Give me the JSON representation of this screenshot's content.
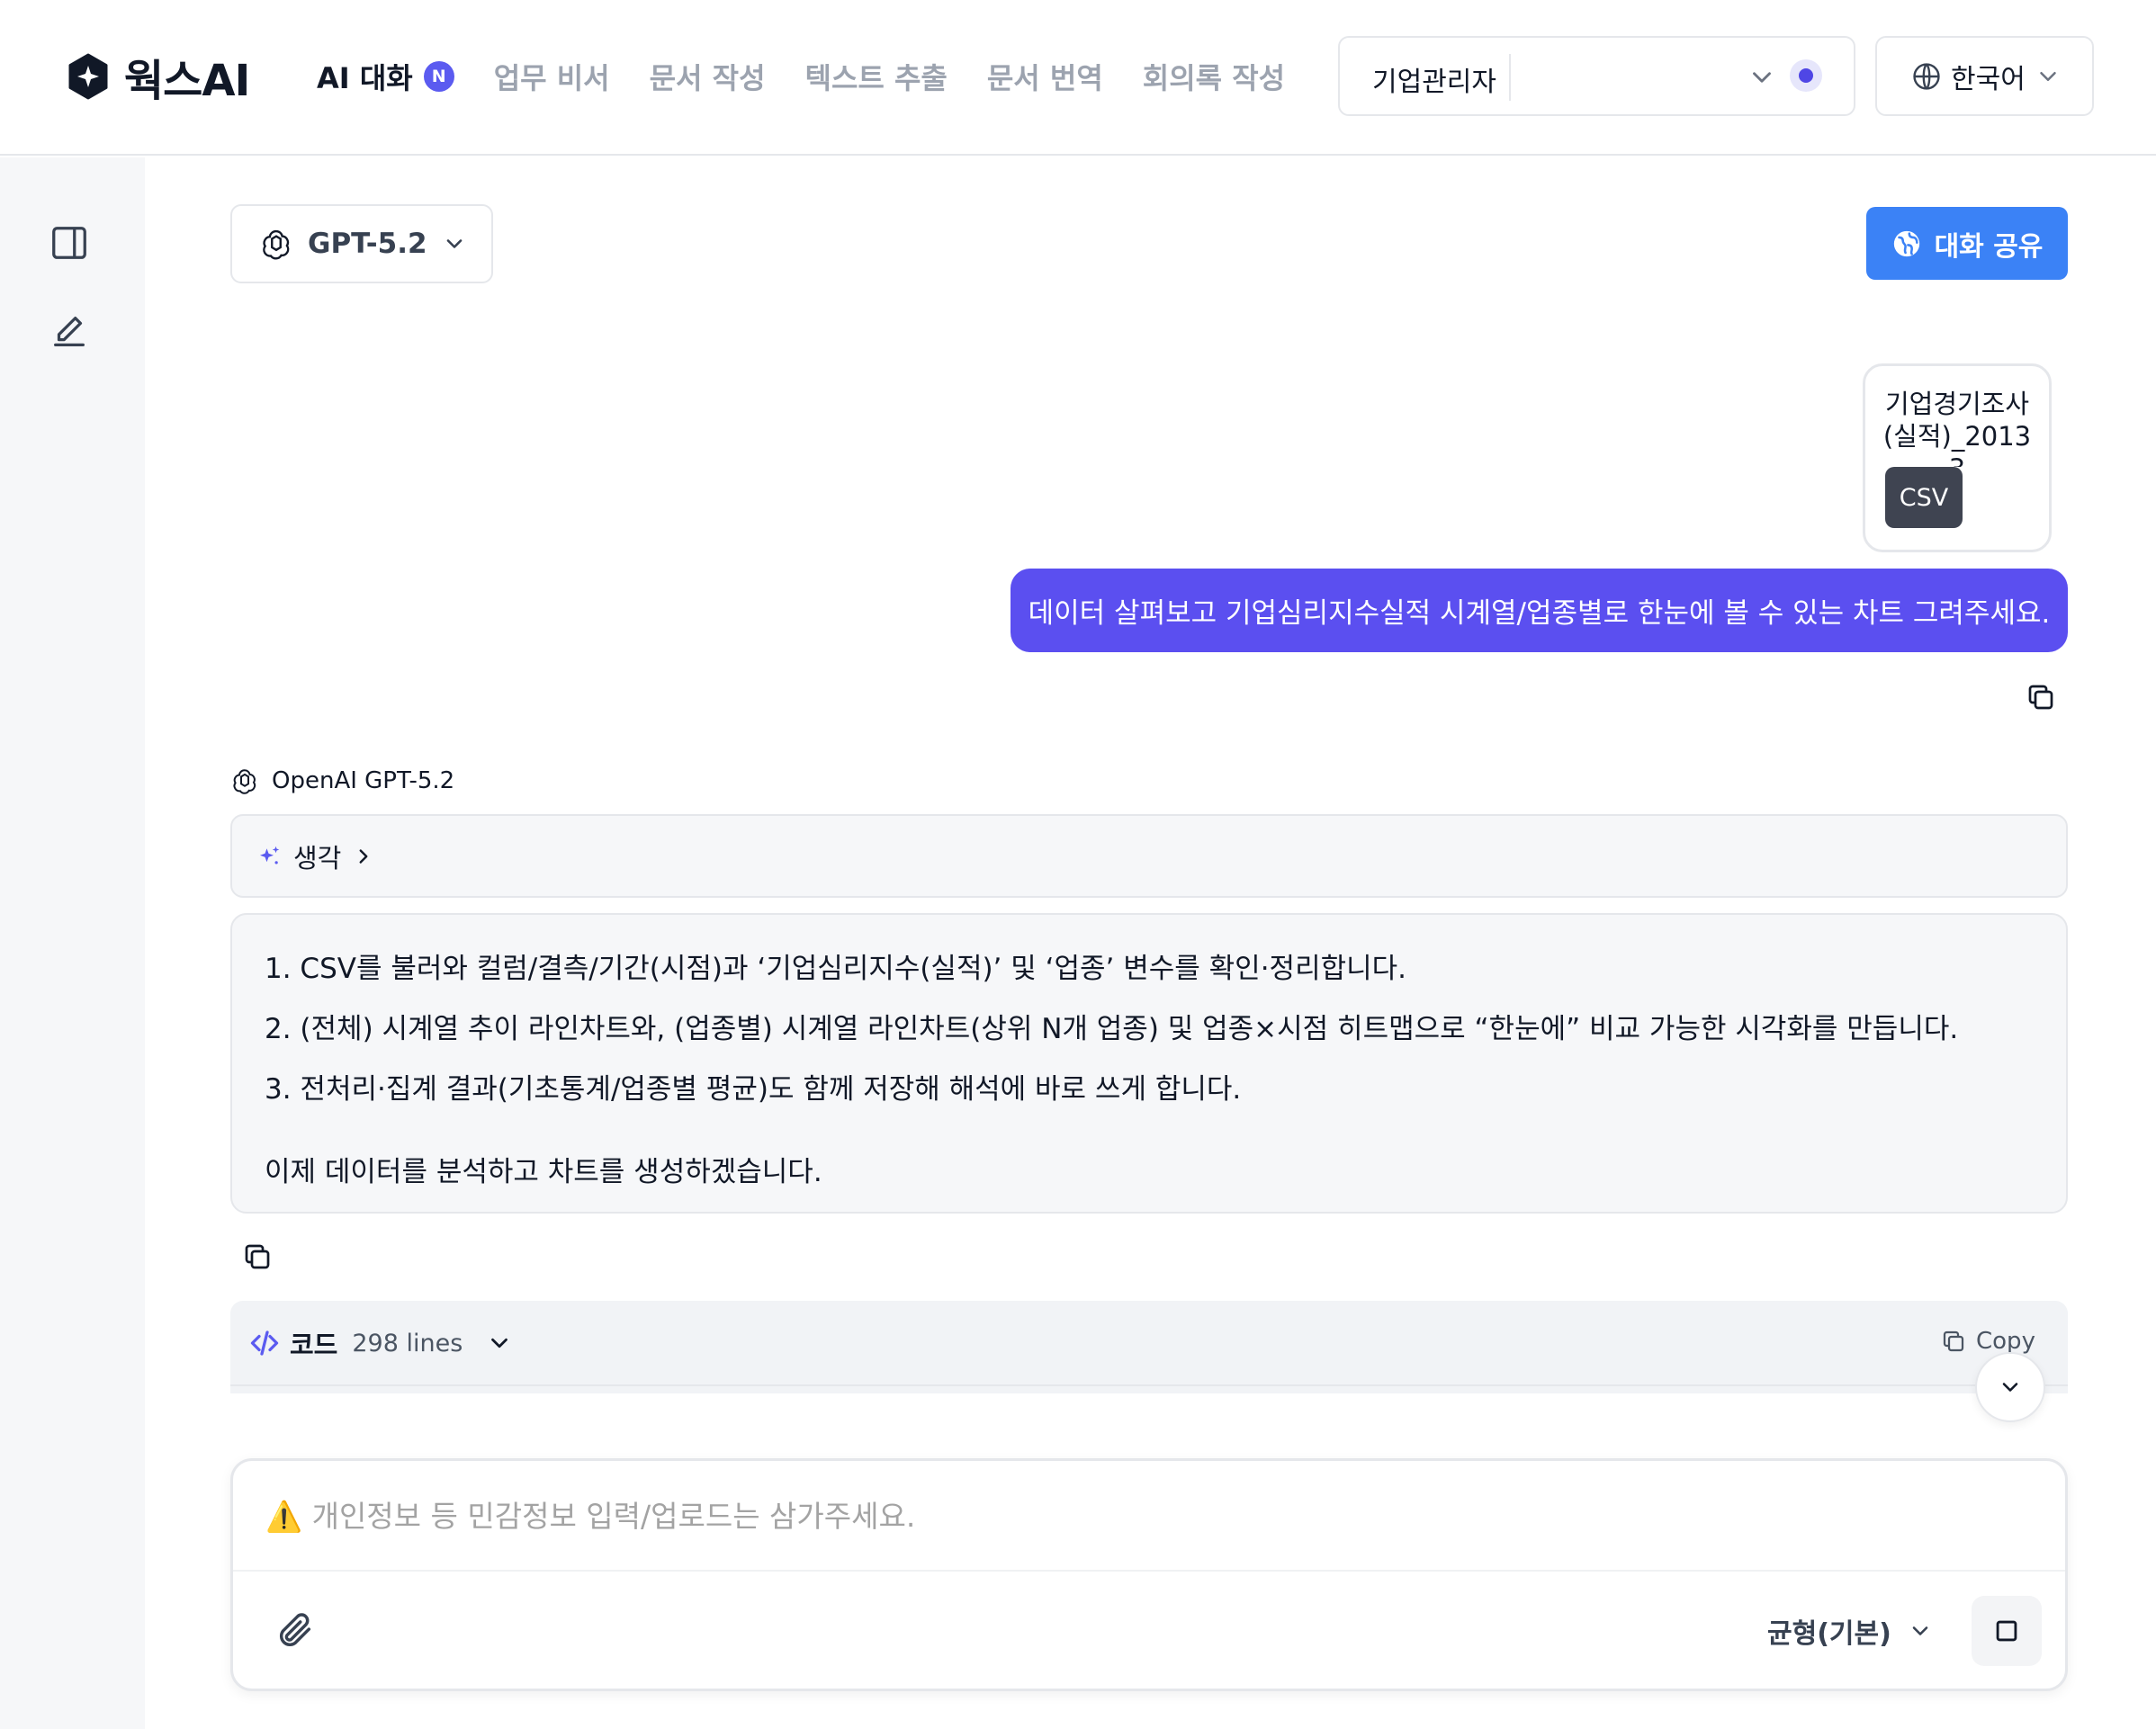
{
  "brand": {
    "name": "웍스AI"
  },
  "nav": {
    "items": [
      {
        "label": "AI 대화",
        "badge": "N",
        "active": true
      },
      {
        "label": "업무 비서"
      },
      {
        "label": "문서 작성"
      },
      {
        "label": "텍스트 추출"
      },
      {
        "label": "문서 번역"
      },
      {
        "label": "회의록 작성"
      }
    ]
  },
  "org_select": {
    "label": "기업관리자"
  },
  "language": {
    "label": "한국어"
  },
  "sidebar": {
    "icons": [
      "sidebar-toggle-icon",
      "new-chat-icon"
    ]
  },
  "model": {
    "label": "GPT-5.2"
  },
  "share": {
    "label": "대화 공유"
  },
  "attachment": {
    "name": "기업경기조사(실적)_20133",
    "type": "CSV"
  },
  "user_message": {
    "text": "데이터 살펴보고 기업심리지수실적 시계열/업종별로 한눈에 볼 수 있는 차트 그려주세요."
  },
  "assistant": {
    "name": "OpenAI GPT-5.2",
    "thinking_label": "생각",
    "plan": [
      "1. CSV를 불러와 컬럼/결측/기간(시점)과 ‘기업심리지수(실적)’ 및 ‘업종’ 변수를 확인·정리합니다.",
      "2. (전체) 시계열 추이 라인차트와, (업종별) 시계열 라인차트(상위 N개 업종) 및 업종×시점 히트맵으로 “한눈에” 비교 가능한 시각화를 만듭니다.",
      "3. 전처리·집계 결과(기초통계/업종별 평균)도 함께 저장해 해석에 바로 쓰게 합니다."
    ],
    "closing": "이제 데이터를 분석하고 차트를 생성하겠습니다."
  },
  "code_block": {
    "title": "코드",
    "lines": "298 lines",
    "copy_label": "Copy"
  },
  "composer": {
    "placeholder": "개인정보 등 민감정보 입력/업로드는 삼가주세요.",
    "warning_icon": "⚠️",
    "mode_label": "균형(기본)"
  },
  "colors": {
    "accent": "#5b4ff0",
    "share": "#3b82f6",
    "badge": "#5b5bf0"
  }
}
